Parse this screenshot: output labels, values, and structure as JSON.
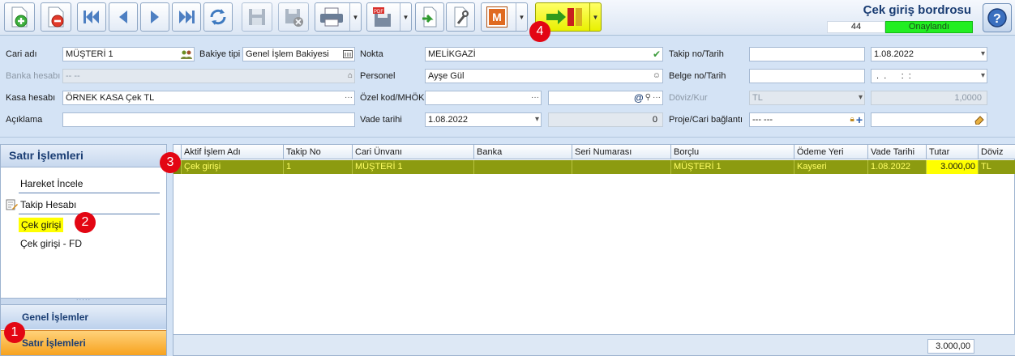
{
  "header": {
    "title": "Çek giriş bordrosu",
    "number": "44",
    "status": "Onaylandı",
    "status_color": "#22ee22",
    "toolbar_icons": [
      "add-icon",
      "delete-icon",
      "first-icon",
      "prev-icon",
      "next-icon",
      "last-icon",
      "refresh-icon",
      "save-icon",
      "cancel-icon",
      "print-icon",
      "pdf-icon",
      "export-icon",
      "tools-icon",
      "m-icon",
      "transfer-icon",
      "help-icon"
    ],
    "m_label": "M"
  },
  "form": {
    "cari_adi_label": "Cari adı",
    "cari_adi_value": "MÜŞTERİ 1",
    "bakiye_tipi_label": "Bakiye tipi",
    "bakiye_tipi_value": "Genel İşlem Bakiyesi",
    "nokta_label": "Nokta",
    "nokta_value": "MELİKGAZİ",
    "takip_label": "Takip no/Tarih",
    "takip_no_value": "",
    "takip_tarih_value": "1.08.2022",
    "banka_label": "Banka hesabı",
    "banka_value": "-- --",
    "personel_label": "Personel",
    "personel_value": "Ayşe Gül",
    "belge_label": "Belge no/Tarih",
    "belge_no_value": "",
    "belge_tarih_value": " .  .      :  :",
    "kasa_label": "Kasa hesabı",
    "kasa_value": "ÖRNEK KASA Çek TL",
    "ozel_kod_label": "Özel kod/MHÖK",
    "ozel_kod_value": "",
    "mhok_value": "",
    "doviz_label": "Döviz/Kur",
    "doviz_value": "TL",
    "kur_value": "1,0000",
    "aciklama_label": "Açıklama",
    "aciklama_value": "",
    "vade_label": "Vade tarihi",
    "vade_value": "1.08.2022",
    "vade_gun_value": "0",
    "proje_label": "Proje/Cari bağlantı",
    "proje_value": "--- ---",
    "proje2_value": "",
    "ellipsis": "···",
    "at_sign": "@"
  },
  "left_panel": {
    "title": "Satır İşlemleri",
    "items": [
      "Hareket İncele",
      "Takip Hesabı",
      "Çek girişi",
      "Çek girişi - FD"
    ],
    "grip": "·····",
    "group1": "Genel İşlemler",
    "group2": "Satır İşlemleri"
  },
  "grid": {
    "columns": [
      "Aktif İşlem Adı",
      "Takip No",
      "Cari Ünvanı",
      "Banka",
      "Seri Numarası",
      "Borçlu",
      "Ödeme Yeri",
      "Vade Tarihi",
      "Tutar",
      "Döviz"
    ],
    "rows": [
      [
        "Çek girişi",
        "1",
        "MÜŞTERİ 1",
        "",
        "",
        "MÜŞTERİ 1",
        "Kayseri",
        "1.08.2022",
        "3.000,00",
        "TL"
      ]
    ],
    "footer_total": "3.000,00"
  },
  "badges": [
    "1",
    "2",
    "3",
    "4"
  ]
}
